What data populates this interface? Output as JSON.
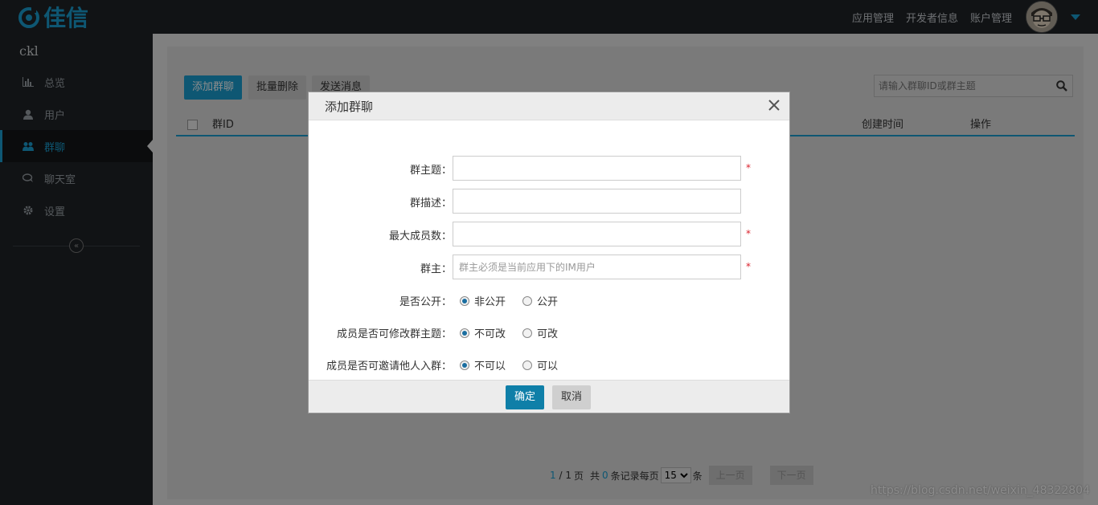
{
  "brand": {
    "name": "佳信"
  },
  "topnav": {
    "items": [
      "应用管理",
      "开发者信息",
      "账户管理"
    ]
  },
  "sidebar": {
    "user": "ckl",
    "items": [
      {
        "label": "总览",
        "icon": "bar-chart-icon"
      },
      {
        "label": "用户",
        "icon": "user-icon"
      },
      {
        "label": "群聊",
        "icon": "group-icon",
        "active": true
      },
      {
        "label": "聊天室",
        "icon": "chat-icon"
      },
      {
        "label": "设置",
        "icon": "gear-icon"
      }
    ]
  },
  "toolbar": {
    "add_label": "添加群聊",
    "batch_delete_label": "批量删除",
    "send_label": "发送消息"
  },
  "search": {
    "placeholder": "请输入群聊ID或群主题"
  },
  "table": {
    "columns": [
      "群ID",
      "创建时间",
      "操作"
    ]
  },
  "pager": {
    "current": "1",
    "total_pages": "1",
    "page_text": "页",
    "records_prefix": "共",
    "records": "0",
    "records_suffix": "条记录每页",
    "page_size": "15",
    "unit": "条",
    "prev_label": "上一页",
    "next_label": "下一页"
  },
  "modal": {
    "title": "添加群聊",
    "fields": {
      "subject_label": "群主题：",
      "desc_label": "群描述：",
      "max_label": "最大成员数：",
      "owner_label": "群主：",
      "owner_placeholder": "群主必须是当前应用下的IM用户",
      "required_mark": "*"
    },
    "radios": {
      "public_label": "是否公开：",
      "public_options": [
        "非公开",
        "公开"
      ],
      "modify_label": "成员是否可修改群主题：",
      "modify_options": [
        "不可改",
        "可改"
      ],
      "invite_label": "成员是否可邀请他人入群：",
      "invite_options": [
        "不可以",
        "可以"
      ]
    },
    "confirm_label": "确定",
    "cancel_label": "取消"
  },
  "watermark": "https://blog.csdn.net/weixin_48322804",
  "colors": {
    "accent": "#1a9ed1",
    "sidebar_bg": "#1f2327",
    "required": "#d9232d"
  }
}
